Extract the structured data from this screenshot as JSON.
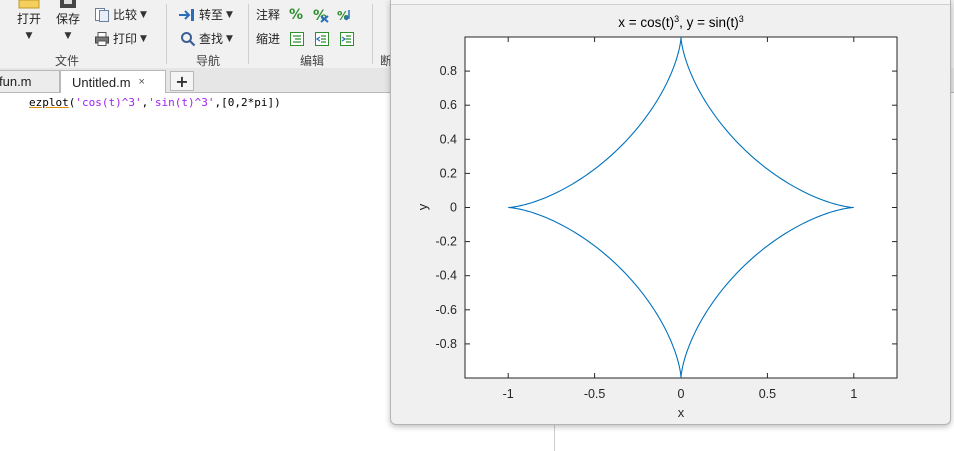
{
  "toolstrip": {
    "file": {
      "open_label": "打开",
      "save_label": "保存",
      "section_label": "文件",
      "compare_label": "比较",
      "print_label": "打印"
    },
    "navigate": {
      "goto_label": "转至",
      "find_label": "查找",
      "section_label": "导航"
    },
    "edit": {
      "comment_label": "注释",
      "indent_label": "缩进",
      "percent_symbol": "%",
      "section_label": "编辑"
    },
    "cut_section_label": "断"
  },
  "tabs": [
    {
      "label": "fun.m"
    },
    {
      "label": "Untitled.m",
      "close": "×"
    }
  ],
  "tab_add": "+",
  "editor": {
    "code": {
      "fn": "ezplot",
      "open": "(",
      "s1": "'cos(t)^3'",
      "c1": ",",
      "s2": "'sin(t)^3'",
      "rest": ",[0,2*pi])"
    }
  },
  "figure": {
    "title_main": "x = cos(t)",
    "title_sup1": "3",
    "title_mid": ", y = sin(t)",
    "title_sup2": "3"
  },
  "chart_data": {
    "type": "line",
    "function": "x = cos(t)^3, y = sin(t)^3",
    "t_range": [
      0,
      6.2832
    ],
    "xlabel": "x",
    "ylabel": "y",
    "xlim": [
      -1.25,
      1.25
    ],
    "ylim": [
      -1,
      1
    ],
    "xticks": [
      -1,
      -0.5,
      0,
      0.5,
      1
    ],
    "xtick_labels": [
      "-1",
      "-0.5",
      "0",
      "0.5",
      "1"
    ],
    "yticks": [
      -0.8,
      -0.6,
      -0.4,
      -0.2,
      0,
      0.2,
      0.4,
      0.6,
      0.8
    ],
    "ytick_labels": [
      "-0.8",
      "-0.6",
      "-0.4",
      "-0.2",
      "0",
      "0.2",
      "0.4",
      "0.6",
      "0.8"
    ],
    "grid": false,
    "line_color": "#0072bd",
    "samples": 300
  }
}
